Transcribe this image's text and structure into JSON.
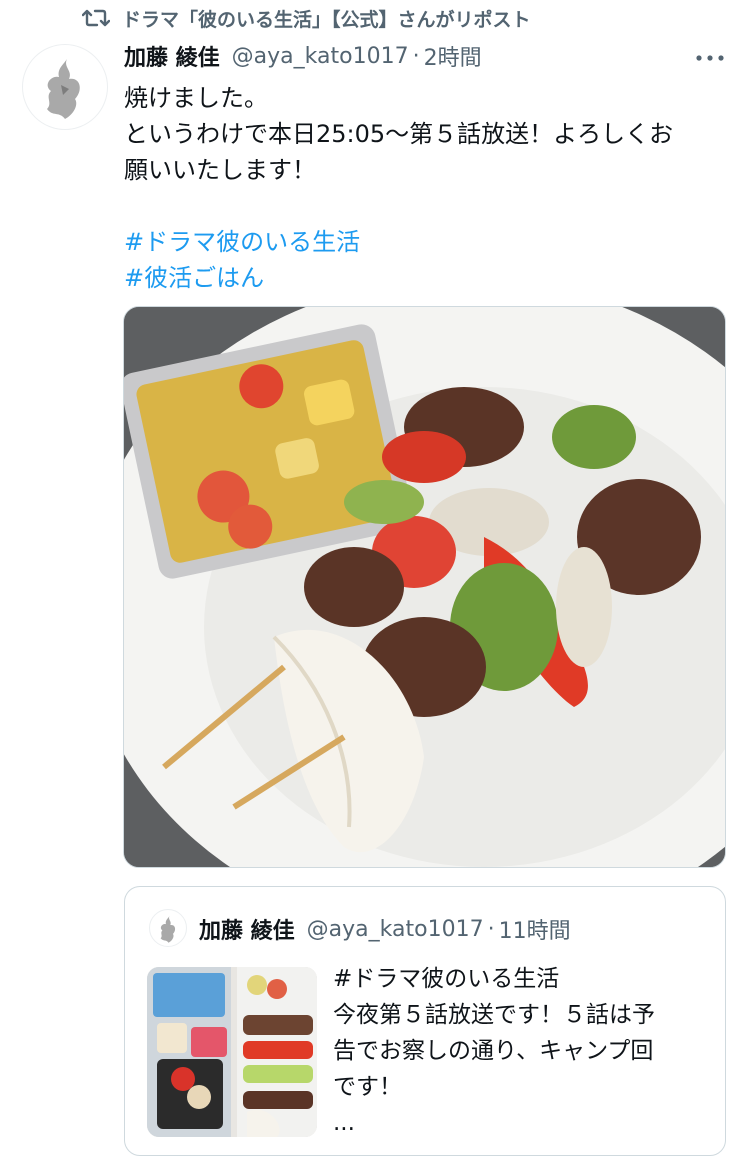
{
  "repost": {
    "label": "ドラマ「彼のいる生活」【公式】さんがリポスト",
    "icon": "repost-icon"
  },
  "tweet": {
    "display_name": "加藤 綾佳",
    "handle": "@aya_kato1017",
    "separator": "·",
    "time": "2時間",
    "text_lines": [
      "焼けました。",
      "というわけで本日25:05〜第５話放送！よろしくお",
      "願いいたします！"
    ],
    "hashtags": [
      "#ドラマ彼のいる生活",
      "#彼活ごはん"
    ],
    "more_icon": "more-icon"
  },
  "quote": {
    "display_name": "加藤 綾佳",
    "handle": "@aya_kato1017",
    "separator": "·",
    "time": "11時間",
    "text_lines": [
      "#ドラマ彼のいる生活",
      "今夜第５話放送です！５話は予",
      "告でお察しの通り、キャンプ回",
      "です！",
      "..."
    ]
  },
  "colors": {
    "text": "#0f1419",
    "secondary": "#536471",
    "link": "#1d9bf0",
    "border": "#cfd9de"
  }
}
